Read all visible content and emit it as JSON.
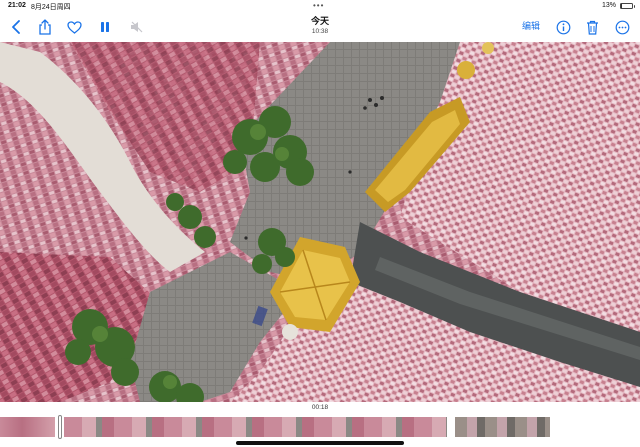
{
  "status_bar": {
    "time": "21:02",
    "date": "8月24日周四",
    "battery_percent_text": "13%",
    "battery_level": 0.13
  },
  "toolbar": {
    "title": "今天",
    "subtitle": "10:38",
    "edit_label": "编辑",
    "accent_color": "#1a73e8",
    "icons": [
      "chevron-left-icon",
      "share-icon",
      "heart-icon",
      "pause-icon",
      "speaker-muted-icon",
      "info-icon",
      "trash-icon",
      "more-icon"
    ]
  },
  "video": {
    "timestamp": "00:18",
    "playback_progress": 0.1
  }
}
